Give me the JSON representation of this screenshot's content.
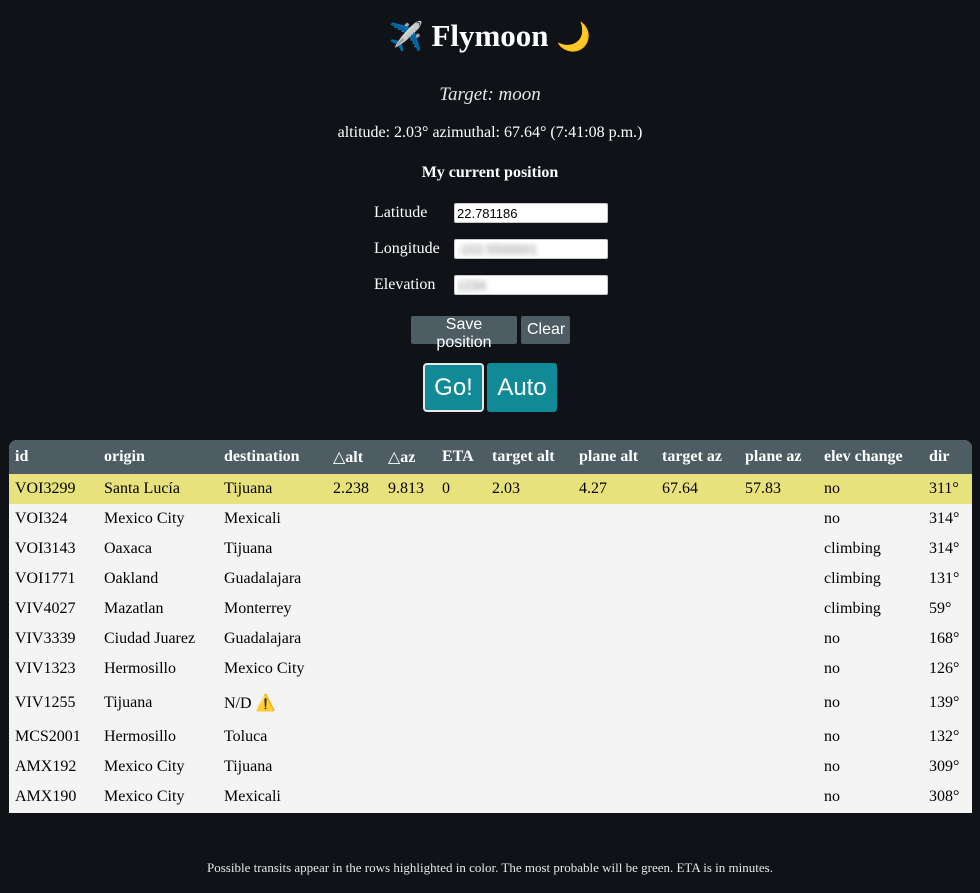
{
  "header": {
    "plane_icon": "✈️",
    "title": "Flymoon",
    "moon_icon": "🌙"
  },
  "target_text": "Target: moon",
  "coords_text": "altitude: 2.03° azimuthal: 67.64° (7:41:08 p.m.)",
  "position": {
    "heading": "My current position",
    "latitude_label": "Latitude",
    "latitude_value": "22.781186",
    "longitude_label": "Longitude",
    "longitude_value": "-102.5500001",
    "elevation_label": "Elevation",
    "elevation_value": "1234"
  },
  "buttons": {
    "save": "Save position",
    "clear": "Clear",
    "go": "Go!",
    "auto": "Auto"
  },
  "table": {
    "headers": [
      "id",
      "origin",
      "destination",
      "△alt",
      "△az",
      "ETA",
      "target alt",
      "plane alt",
      "target az",
      "plane az",
      "elev change",
      "dir"
    ],
    "rows": [
      {
        "id": "VOI3299",
        "origin": "Santa Lucía",
        "destination": "Tijuana",
        "dalt": "2.238",
        "daz": "9.813",
        "eta": "0",
        "target_alt": "2.03",
        "plane_alt": "4.27",
        "target_az": "67.64",
        "plane_az": "57.83",
        "elev": "no",
        "dir": "311°"
      },
      {
        "id": "VOI324",
        "origin": "Mexico City",
        "destination": "Mexicali",
        "dalt": "",
        "daz": "",
        "eta": "",
        "target_alt": "",
        "plane_alt": "",
        "target_az": "",
        "plane_az": "",
        "elev": "no",
        "dir": "314°"
      },
      {
        "id": "VOI3143",
        "origin": "Oaxaca",
        "destination": "Tijuana",
        "dalt": "",
        "daz": "",
        "eta": "",
        "target_alt": "",
        "plane_alt": "",
        "target_az": "",
        "plane_az": "",
        "elev": "climbing",
        "dir": "314°"
      },
      {
        "id": "VOI1771",
        "origin": "Oakland",
        "destination": "Guadalajara",
        "dalt": "",
        "daz": "",
        "eta": "",
        "target_alt": "",
        "plane_alt": "",
        "target_az": "",
        "plane_az": "",
        "elev": "climbing",
        "dir": "131°"
      },
      {
        "id": "VIV4027",
        "origin": "Mazatlan",
        "destination": "Monterrey",
        "dalt": "",
        "daz": "",
        "eta": "",
        "target_alt": "",
        "plane_alt": "",
        "target_az": "",
        "plane_az": "",
        "elev": "climbing",
        "dir": "59°"
      },
      {
        "id": "VIV3339",
        "origin": "Ciudad Juarez",
        "destination": "Guadalajara",
        "dalt": "",
        "daz": "",
        "eta": "",
        "target_alt": "",
        "plane_alt": "",
        "target_az": "",
        "plane_az": "",
        "elev": "no",
        "dir": "168°"
      },
      {
        "id": "VIV1323",
        "origin": "Hermosillo",
        "destination": "Mexico City",
        "dalt": "",
        "daz": "",
        "eta": "",
        "target_alt": "",
        "plane_alt": "",
        "target_az": "",
        "plane_az": "",
        "elev": "no",
        "dir": "126°"
      },
      {
        "id": "VIV1255",
        "origin": "Tijuana",
        "destination": "N/D",
        "dalt": "",
        "daz": "",
        "eta": "",
        "target_alt": "",
        "plane_alt": "",
        "target_az": "",
        "plane_az": "",
        "elev": "no",
        "dir": "139°"
      },
      {
        "id": "MCS2001",
        "origin": "Hermosillo",
        "destination": "Toluca",
        "dalt": "",
        "daz": "",
        "eta": "",
        "target_alt": "",
        "plane_alt": "",
        "target_az": "",
        "plane_az": "",
        "elev": "no",
        "dir": "132°"
      },
      {
        "id": "AMX192",
        "origin": "Mexico City",
        "destination": "Tijuana",
        "dalt": "",
        "daz": "",
        "eta": "",
        "target_alt": "",
        "plane_alt": "",
        "target_az": "",
        "plane_az": "",
        "elev": "no",
        "dir": "309°"
      },
      {
        "id": "AMX190",
        "origin": "Mexico City",
        "destination": "Mexicali",
        "dalt": "",
        "daz": "",
        "eta": "",
        "target_alt": "",
        "plane_alt": "",
        "target_az": "",
        "plane_az": "",
        "elev": "no",
        "dir": "308°"
      }
    ]
  },
  "warning_icon": "⚠️",
  "footer": "Possible transits appear in the rows highlighted in color. The most probable will be green. ETA is in minutes."
}
